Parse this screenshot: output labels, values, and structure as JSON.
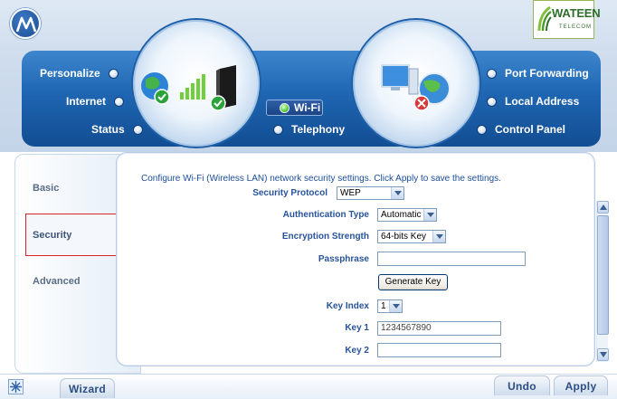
{
  "brand": {
    "router_logo_icon": "motorola-logo",
    "isp_logo": {
      "name": "WATEEN",
      "sub": "TELECOM"
    }
  },
  "nav": {
    "left": [
      {
        "label": "Personalize"
      },
      {
        "label": "Internet"
      },
      {
        "label": "Status"
      }
    ],
    "center": [
      {
        "label": "Wi-Fi",
        "selected": true
      },
      {
        "label": "Telephony",
        "selected": false
      }
    ],
    "right": [
      {
        "label": "Port Forwarding"
      },
      {
        "label": "Local Address"
      },
      {
        "label": "Control Panel"
      }
    ]
  },
  "sidebar": {
    "items": [
      {
        "label": "Basic"
      },
      {
        "label": "Security",
        "selected": true
      },
      {
        "label": "Advanced"
      }
    ]
  },
  "main": {
    "intro": "Configure Wi-Fi (Wireless LAN) network security settings. Click Apply to save the settings.",
    "security_protocol": {
      "label": "Security Protocol",
      "value": "WEP"
    },
    "auth_type": {
      "label": "Authentication Type",
      "value": "Automatic"
    },
    "encryption_strength": {
      "label": "Encryption Strength",
      "value": "64-bits Key"
    },
    "passphrase": {
      "label": "Passphrase",
      "value": ""
    },
    "generate_key": "Generate Key",
    "key_index": {
      "label": "Key Index",
      "value": "1"
    },
    "key1": {
      "label": "Key 1",
      "value": "1234567890"
    },
    "key2": {
      "label": "Key 2",
      "value": ""
    }
  },
  "footer": {
    "wizard": "Wizard",
    "undo": "Undo",
    "apply": "Apply"
  },
  "colors": {
    "nav_band": "#1f66b2",
    "label_blue": "#28539a",
    "selection_border": "#d8242a",
    "status_green": "#5ed23a"
  }
}
